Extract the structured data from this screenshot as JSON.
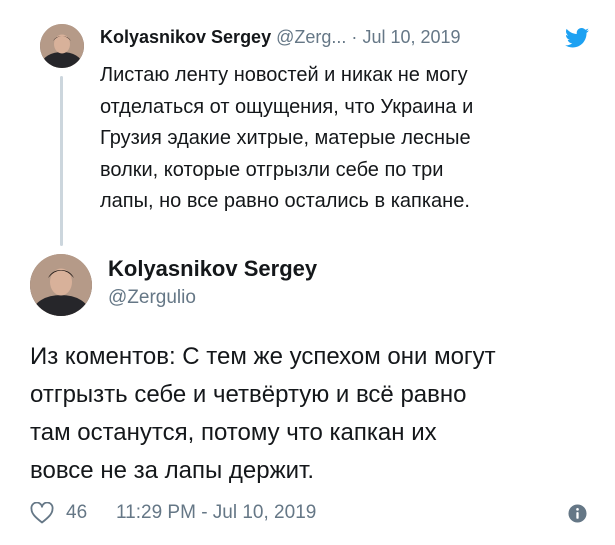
{
  "quoted_tweet": {
    "author_name": "Kolyasnikov Sergey",
    "handle": "@Zerg...",
    "separator": "·",
    "date": "Jul 10, 2019",
    "text": "Листаю ленту новостей и никак не могу\nотделаться от ощущения, что Украина и\nГрузия эдакие хитрые, матерые лесные\nволки, которые отгрызли себе по три\nлапы, но все равно остались в капкане."
  },
  "main_tweet": {
    "author_name": "Kolyasnikov Sergey",
    "handle": "@Zergulio",
    "text": "Из коментов: С тем же успехом они могут\nотгрызть себе и четвёртую и всё равно\nтам останутся, потому что капкан их\nвовсе не за лапы держит.",
    "likes": "46",
    "timestamp": "11:29 PM - Jul 10, 2019"
  },
  "colors": {
    "text": "#14171a",
    "secondary": "#657786",
    "twitter_blue": "#1da1f2",
    "thread_line": "#ccd6dd"
  },
  "icons": {
    "brand": "twitter-bird-icon",
    "like": "heart-icon",
    "info": "info-icon"
  }
}
